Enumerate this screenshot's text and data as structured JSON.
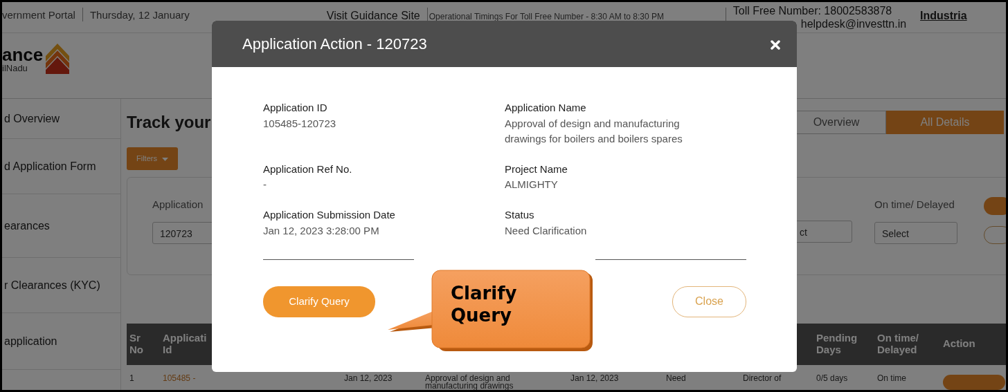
{
  "top_bar": {
    "portal": "vernment Portal",
    "date": "Thursday, 12 January",
    "guidance_link": "Visit Guidance Site",
    "timings": "Operational Timings For Toll Free Number - 8:30 AM to 8:30 PM",
    "toll_free": "Toll Free Number: 18002583878",
    "email": "helpdesk@investtn.in",
    "industries_link": "Industria"
  },
  "logo": {
    "line_1": "ance",
    "line_2": "ilNadu"
  },
  "sidebar": {
    "items": [
      {
        "label": "d Overview"
      },
      {
        "label": "d Application Form"
      },
      {
        "label": "earances"
      },
      {
        "label": "r Clearances (KYC)"
      },
      {
        "label": "application"
      }
    ]
  },
  "page_title": "Track your",
  "view_tabs": [
    {
      "label": "Overview",
      "selected": false
    },
    {
      "label": "All Details",
      "selected": true
    }
  ],
  "filters_button": "Filters",
  "filter_fields": {
    "application": {
      "label": "Application",
      "value": "120723"
    },
    "status": {
      "value": "ct"
    },
    "on_time": {
      "label": "On time/ Delayed",
      "value": "Select"
    }
  },
  "table": {
    "columns": [
      {
        "label": "Sr No"
      },
      {
        "label": "Applicati Id"
      },
      {},
      {},
      {},
      {},
      {},
      {
        "label": "Pending Days"
      },
      {
        "label": "On time/ Delayed"
      },
      {
        "label": "Action"
      }
    ],
    "rows": [
      {
        "cells": [
          "1",
          "105485 -",
          "Jan 12, 2023",
          "Approval of design and manufacturing drawings",
          "Jan 12, 2023",
          "Need",
          "Director of",
          "0/5 days",
          "On time"
        ]
      }
    ]
  },
  "modal": {
    "title": "Application Action - 120723",
    "fields": [
      {
        "label": "Application ID",
        "value": "105485-120723"
      },
      {
        "label": "Application Name",
        "value": "Approval of design and manufacturing drawings for boilers and boilers spares"
      },
      {
        "label": "Application Ref No.",
        "value": "-"
      },
      {
        "label": "Project Name",
        "value": "ALMIGHTY"
      },
      {
        "label": "Application Submission Date",
        "value": "Jan 12, 2023 3:28:00 PM"
      },
      {
        "label": "Status",
        "value": "Need Clarification"
      }
    ],
    "primary_button": "Clarify Query",
    "secondary_button": "Close"
  },
  "callout": "Clarify Query"
}
